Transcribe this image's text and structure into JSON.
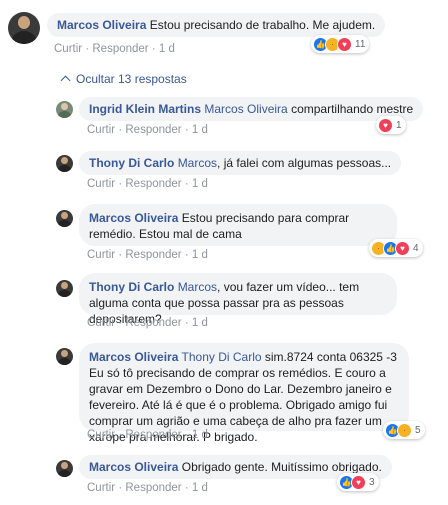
{
  "toggle": {
    "label": "Ocultar 13 respostas",
    "chevron": "chevron-up-icon"
  },
  "actions": {
    "like": "Curtir",
    "reply": "Responder",
    "sep": "·"
  },
  "reactions_icons": [
    "like-icon",
    "sad-icon",
    "love-icon"
  ],
  "comments": [
    {
      "name": "Marcos Oliveira",
      "tag": "",
      "text": "Estou precisando de trabalho. Me ajudem.",
      "time": "1 d",
      "reactions": "11"
    },
    {
      "name": "Ingrid Klein Martins",
      "tag": "Marcos Oliveira",
      "text": "compartilhando mestre",
      "time": "1 d",
      "reactions": "1"
    },
    {
      "name": "Thony Di Carlo",
      "tag": "Marcos",
      "text": ", já falei com algumas pessoas...",
      "time": "1 d",
      "reactions": ""
    },
    {
      "name": "Marcos Oliveira",
      "tag": "",
      "text": "Estou precisando para comprar remédio. Estou mal de cama",
      "time": "1 d",
      "reactions": "4"
    },
    {
      "name": "Thony Di Carlo",
      "tag": "Marcos",
      "text": ", vou fazer um vídeo... tem alguma conta que possa passar pra as pessoas depositarem?",
      "time": "1 d",
      "reactions": ""
    },
    {
      "name": "Marcos Oliveira",
      "tag": "Thony Di Carlo",
      "text": "sim.8724 conta 06325 -3 Eu só tô precisando de comprar os remédios. E couro a gravar em Dezembro o Dono do Lar. Dezembro janeiro e fevereiro. Até lá é que é o problema. Obrigado amigo fui comprar um agrião e uma cabeça de alho pra fazer um xarope pra melhorar. P brigado.",
      "time": "1 d",
      "reactions": "5"
    },
    {
      "name": "Marcos Oliveira",
      "tag": "",
      "text": "Obrigado gente. Muitíssimo obrigado.",
      "time": "1 d",
      "reactions": "3"
    }
  ]
}
